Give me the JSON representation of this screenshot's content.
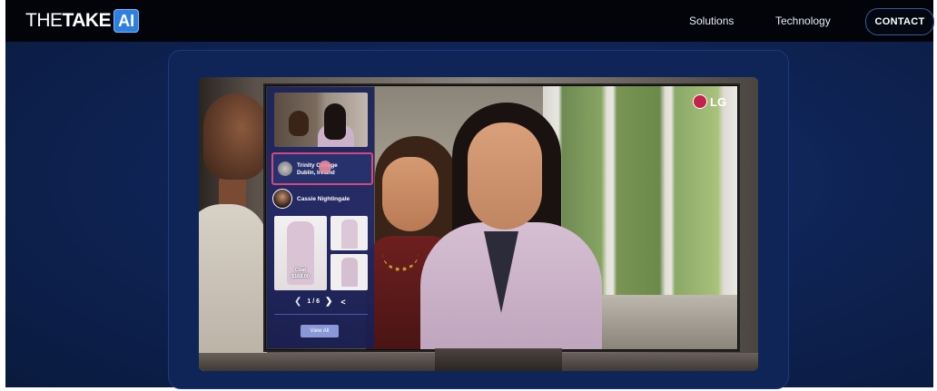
{
  "nav": {
    "logo_the": "THE",
    "logo_take": "TAKE",
    "logo_ai": "AI",
    "links": [
      "Solutions",
      "Technology"
    ],
    "contact_label": "CONTACT"
  },
  "tv_overlay": {
    "brand": "LG",
    "location_title": "Trinity College",
    "location_subtitle": "Dublin, Ireland",
    "person_name": "Cassie Nightingale",
    "product_label": "Coat",
    "product_price": "$168.00",
    "pager_text": "1 / 6",
    "view_all_label": "View All"
  },
  "colors": {
    "background": "#0a1a3e",
    "navbar": "#020409",
    "logo_ai_bg": "#2f7fe0",
    "lg_red": "#c4214b",
    "overlay_highlight": "#d14a7e"
  },
  "icons": {
    "prev": "chevron-left-icon",
    "next": "chevron-right-icon",
    "share": "share-icon"
  }
}
